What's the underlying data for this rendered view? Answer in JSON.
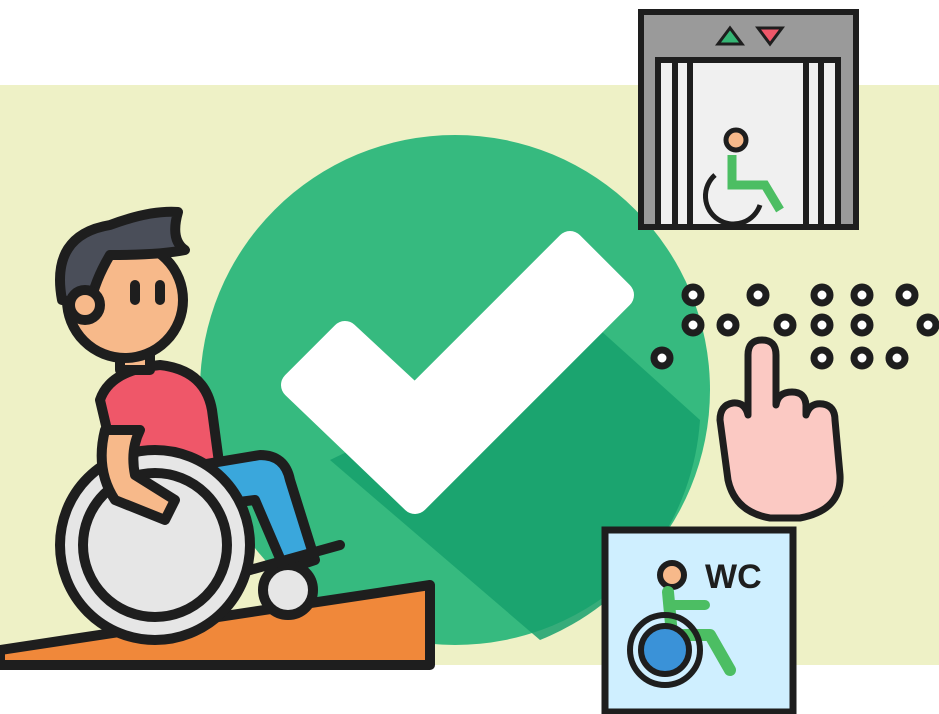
{
  "scene": {
    "description_icons": [
      "wheelchair-user-icon",
      "checkmark-icon",
      "elevator-icon",
      "braille-icon",
      "pointing-hand-icon",
      "accessible-restroom-icon"
    ],
    "colors": {
      "background_band": "#eef1c6",
      "check_circle": "#36ba7f",
      "check_circle_shadow": "#16a06c",
      "ramp": "#f0883a",
      "shirt": "#ef5769",
      "skin": "#f7b98a",
      "hair": "#4a4e59",
      "pants": "#3aa7dc",
      "wheel": "#e6e6e6",
      "outline": "#1e1e1e",
      "elevator_frame": "#9a9a9a",
      "elevator_inside": "#f0f0f0",
      "arrow_up": "#35b574",
      "arrow_down": "#ef5769",
      "wheelchair_figure": "#4cbe63",
      "wc_sign_bg": "#cfefff",
      "wc_wheel": "#3a92d8",
      "hand": "#fbc9c3"
    }
  },
  "wc_sign": {
    "label": "WC"
  }
}
